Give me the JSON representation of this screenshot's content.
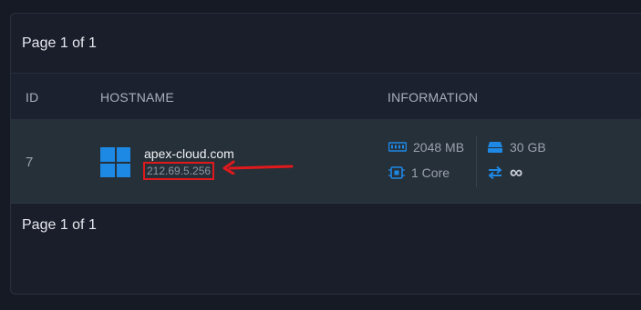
{
  "pager": {
    "top_label": "Page 1 of 1",
    "bottom_label": "Page 1 of 1"
  },
  "table": {
    "headers": [
      "ID",
      "HOSTNAME",
      "INFORMATION"
    ],
    "rows": [
      {
        "id": "7",
        "os_icon": "windows-logo-icon",
        "hostname": "apex-cloud.com",
        "ip": "212.69.5.256",
        "memory": "2048 MB",
        "cpu": "1 Core",
        "disk": "30 GB",
        "bandwidth": "∞"
      }
    ]
  },
  "annotation": {
    "highlight_color": "#e0191c",
    "arrow_icon": "red-arrow-left-icon"
  },
  "colors": {
    "accent": "#1e88e5",
    "row_bg": "#263039",
    "page_bg": "#161a25"
  }
}
